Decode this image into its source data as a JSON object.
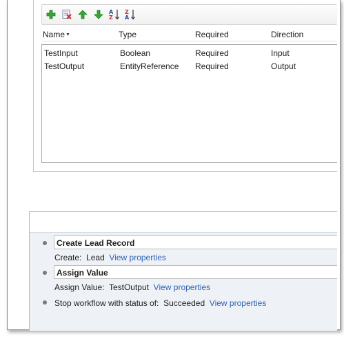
{
  "toolbar": {
    "buttons": [
      {
        "name": "add-argument-button",
        "icon": "plus-icon"
      },
      {
        "name": "delete-argument-button",
        "icon": "delete-icon"
      },
      {
        "name": "move-up-button",
        "icon": "arrow-up-icon"
      },
      {
        "name": "move-down-button",
        "icon": "arrow-down-icon"
      },
      {
        "name": "sort-ascending-button",
        "icon": "sort-az-icon"
      },
      {
        "name": "sort-descending-button",
        "icon": "sort-za-icon"
      }
    ]
  },
  "grid": {
    "columns": {
      "name": "Name",
      "type": "Type",
      "required": "Required",
      "direction": "Direction"
    },
    "rows": [
      {
        "name": "TestInput",
        "type": "Boolean",
        "required": "Required",
        "direction": "Input"
      },
      {
        "name": "TestOutput",
        "type": "EntityReference",
        "required": "Required",
        "direction": "Output"
      }
    ]
  },
  "steps": {
    "create_lead": {
      "title": "Create Lead Record",
      "detail_label": "Create:",
      "detail_value": "Lead",
      "link": "View properties"
    },
    "assign_value": {
      "title": "Assign Value",
      "detail_label": "Assign Value:",
      "detail_value": "TestOutput",
      "link": "View properties"
    },
    "stop_workflow": {
      "label": "Stop workflow with status of:",
      "value": "Succeeded",
      "link": "View properties"
    }
  },
  "colors": {
    "link": "#2f63b7",
    "panel_bg": "#eef1f5",
    "icon_green": "#3aa635"
  }
}
